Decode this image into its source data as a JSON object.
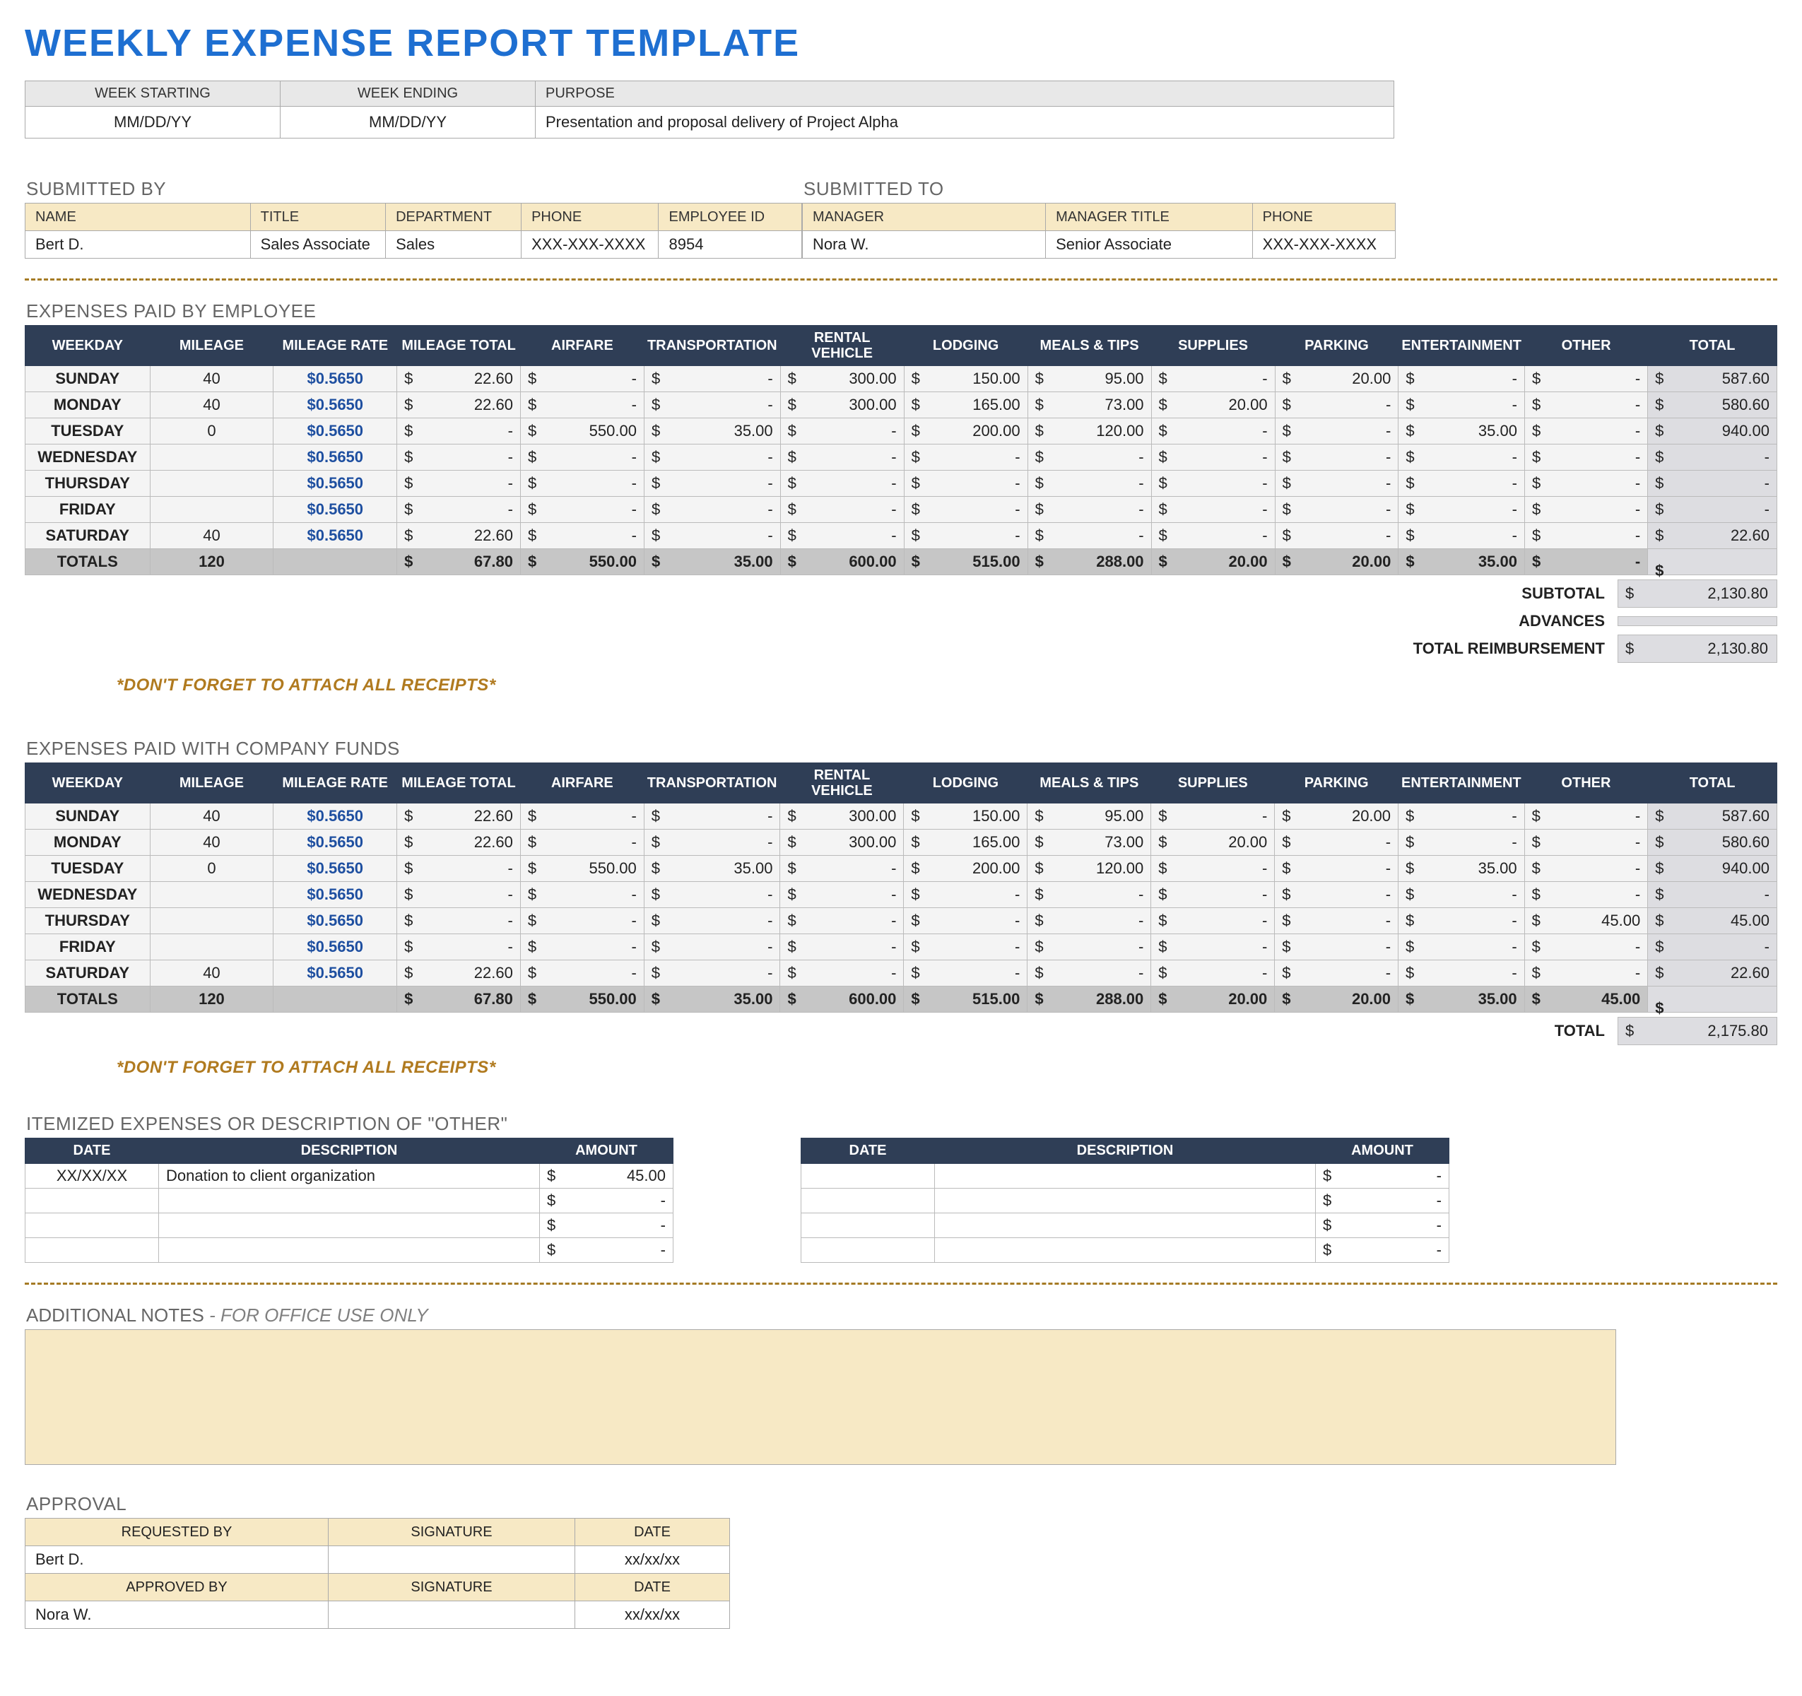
{
  "title": "WEEKLY EXPENSE REPORT TEMPLATE",
  "top": {
    "week_starting_hdr": "WEEK STARTING",
    "week_ending_hdr": "WEEK ENDING",
    "purpose_hdr": "PURPOSE",
    "week_starting": "MM/DD/YY",
    "week_ending": "MM/DD/YY",
    "purpose": "Presentation and proposal delivery of Project Alpha"
  },
  "submitted_by": {
    "section": "SUBMITTED BY",
    "hdr": {
      "name": "NAME",
      "title": "TITLE",
      "dept": "DEPARTMENT",
      "phone": "PHONE",
      "emp": "EMPLOYEE ID"
    },
    "val": {
      "name": "Bert D.",
      "title": "Sales Associate",
      "dept": "Sales",
      "phone": "XXX-XXX-XXXX",
      "emp": "8954"
    }
  },
  "submitted_to": {
    "section": "SUBMITTED TO",
    "hdr": {
      "manager": "MANAGER",
      "title": "MANAGER TITLE",
      "phone": "PHONE"
    },
    "val": {
      "manager": "Nora W.",
      "title": "Senior Associate",
      "phone": "XXX-XXX-XXXX"
    }
  },
  "exp_cols": [
    "WEEKDAY",
    "MILEAGE",
    "MILEAGE RATE",
    "MILEAGE TOTAL",
    "AIRFARE",
    "TRANSPORTATION",
    "RENTAL VEHICLE",
    "LODGING",
    "MEALS & TIPS",
    "SUPPLIES",
    "PARKING",
    "ENTERTAINMENT",
    "OTHER",
    "TOTAL"
  ],
  "exp_colw": [
    168,
    168,
    168,
    168,
    168,
    168,
    168,
    168,
    168,
    168,
    168,
    168,
    168,
    176
  ],
  "emp_section": "EXPENSES PAID BY EMPLOYEE",
  "emp_rows": [
    {
      "day": "SUNDAY",
      "mileage": "40",
      "rate": "$0.5650",
      "mtot": "22.60",
      "air": "-",
      "trans": "-",
      "rent": "300.00",
      "lodg": "150.00",
      "meal": "95.00",
      "sup": "-",
      "park": "20.00",
      "ent": "-",
      "oth": "-",
      "tot": "587.60"
    },
    {
      "day": "MONDAY",
      "mileage": "40",
      "rate": "$0.5650",
      "mtot": "22.60",
      "air": "-",
      "trans": "-",
      "rent": "300.00",
      "lodg": "165.00",
      "meal": "73.00",
      "sup": "20.00",
      "park": "-",
      "ent": "-",
      "oth": "-",
      "tot": "580.60"
    },
    {
      "day": "TUESDAY",
      "mileage": "0",
      "rate": "$0.5650",
      "mtot": "-",
      "air": "550.00",
      "trans": "35.00",
      "rent": "-",
      "lodg": "200.00",
      "meal": "120.00",
      "sup": "-",
      "park": "-",
      "ent": "35.00",
      "oth": "-",
      "tot": "940.00"
    },
    {
      "day": "WEDNESDAY",
      "mileage": "",
      "rate": "$0.5650",
      "mtot": "-",
      "air": "-",
      "trans": "-",
      "rent": "-",
      "lodg": "-",
      "meal": "-",
      "sup": "-",
      "park": "-",
      "ent": "-",
      "oth": "-",
      "tot": "-"
    },
    {
      "day": "THURSDAY",
      "mileage": "",
      "rate": "$0.5650",
      "mtot": "-",
      "air": "-",
      "trans": "-",
      "rent": "-",
      "lodg": "-",
      "meal": "-",
      "sup": "-",
      "park": "-",
      "ent": "-",
      "oth": "-",
      "tot": "-"
    },
    {
      "day": "FRIDAY",
      "mileage": "",
      "rate": "$0.5650",
      "mtot": "-",
      "air": "-",
      "trans": "-",
      "rent": "-",
      "lodg": "-",
      "meal": "-",
      "sup": "-",
      "park": "-",
      "ent": "-",
      "oth": "-",
      "tot": "-"
    },
    {
      "day": "SATURDAY",
      "mileage": "40",
      "rate": "$0.5650",
      "mtot": "22.60",
      "air": "-",
      "trans": "-",
      "rent": "-",
      "lodg": "-",
      "meal": "-",
      "sup": "-",
      "park": "-",
      "ent": "-",
      "oth": "-",
      "tot": "22.60"
    }
  ],
  "emp_totals": {
    "label": "TOTALS",
    "mileage": "120",
    "mtot": "67.80",
    "air": "550.00",
    "trans": "35.00",
    "rent": "600.00",
    "lodg": "515.00",
    "meal": "288.00",
    "sup": "20.00",
    "park": "20.00",
    "ent": "35.00",
    "oth": "-",
    "tot": ""
  },
  "emp_sum": [
    {
      "label": "SUBTOTAL",
      "val": "2,130.80"
    },
    {
      "label": "ADVANCES",
      "val": ""
    },
    {
      "label": "TOTAL REIMBURSEMENT",
      "val": "2,130.80"
    }
  ],
  "reminder": "*DON'T FORGET TO ATTACH ALL RECEIPTS*",
  "co_section": "EXPENSES PAID WITH COMPANY FUNDS",
  "co_rows": [
    {
      "day": "SUNDAY",
      "mileage": "40",
      "rate": "$0.5650",
      "mtot": "22.60",
      "air": "-",
      "trans": "-",
      "rent": "300.00",
      "lodg": "150.00",
      "meal": "95.00",
      "sup": "-",
      "park": "20.00",
      "ent": "-",
      "oth": "-",
      "tot": "587.60"
    },
    {
      "day": "MONDAY",
      "mileage": "40",
      "rate": "$0.5650",
      "mtot": "22.60",
      "air": "-",
      "trans": "-",
      "rent": "300.00",
      "lodg": "165.00",
      "meal": "73.00",
      "sup": "20.00",
      "park": "-",
      "ent": "-",
      "oth": "-",
      "tot": "580.60"
    },
    {
      "day": "TUESDAY",
      "mileage": "0",
      "rate": "$0.5650",
      "mtot": "-",
      "air": "550.00",
      "trans": "35.00",
      "rent": "-",
      "lodg": "200.00",
      "meal": "120.00",
      "sup": "-",
      "park": "-",
      "ent": "35.00",
      "oth": "-",
      "tot": "940.00"
    },
    {
      "day": "WEDNESDAY",
      "mileage": "",
      "rate": "$0.5650",
      "mtot": "-",
      "air": "-",
      "trans": "-",
      "rent": "-",
      "lodg": "-",
      "meal": "-",
      "sup": "-",
      "park": "-",
      "ent": "-",
      "oth": "-",
      "tot": "-"
    },
    {
      "day": "THURSDAY",
      "mileage": "",
      "rate": "$0.5650",
      "mtot": "-",
      "air": "-",
      "trans": "-",
      "rent": "-",
      "lodg": "-",
      "meal": "-",
      "sup": "-",
      "park": "-",
      "ent": "-",
      "oth": "45.00",
      "tot": "45.00"
    },
    {
      "day": "FRIDAY",
      "mileage": "",
      "rate": "$0.5650",
      "mtot": "-",
      "air": "-",
      "trans": "-",
      "rent": "-",
      "lodg": "-",
      "meal": "-",
      "sup": "-",
      "park": "-",
      "ent": "-",
      "oth": "-",
      "tot": "-"
    },
    {
      "day": "SATURDAY",
      "mileage": "40",
      "rate": "$0.5650",
      "mtot": "22.60",
      "air": "-",
      "trans": "-",
      "rent": "-",
      "lodg": "-",
      "meal": "-",
      "sup": "-",
      "park": "-",
      "ent": "-",
      "oth": "-",
      "tot": "22.60"
    }
  ],
  "co_totals": {
    "label": "TOTALS",
    "mileage": "120",
    "mtot": "67.80",
    "air": "550.00",
    "trans": "35.00",
    "rent": "600.00",
    "lodg": "515.00",
    "meal": "288.00",
    "sup": "20.00",
    "park": "20.00",
    "ent": "35.00",
    "oth": "45.00",
    "tot": ""
  },
  "co_sum": [
    {
      "label": "TOTAL",
      "val": "2,175.80"
    }
  ],
  "itemized": {
    "section": "ITEMIZED EXPENSES OR DESCRIPTION OF \"OTHER\"",
    "hdr": {
      "date": "DATE",
      "desc": "DESCRIPTION",
      "amt": "AMOUNT"
    },
    "left": [
      {
        "date": "XX/XX/XX",
        "desc": "Donation to client organization",
        "amt": "45.00"
      },
      {
        "date": "",
        "desc": "",
        "amt": "-"
      },
      {
        "date": "",
        "desc": "",
        "amt": "-"
      },
      {
        "date": "",
        "desc": "",
        "amt": "-"
      }
    ],
    "right": [
      {
        "date": "",
        "desc": "",
        "amt": "-"
      },
      {
        "date": "",
        "desc": "",
        "amt": "-"
      },
      {
        "date": "",
        "desc": "",
        "amt": "-"
      },
      {
        "date": "",
        "desc": "",
        "amt": "-"
      }
    ]
  },
  "notes": {
    "label": "ADDITIONAL NOTES",
    "office": " - FOR OFFICE USE ONLY"
  },
  "approval": {
    "section": "APPROVAL",
    "hdr": {
      "req": "REQUESTED BY",
      "sig": "SIGNATURE",
      "date": "DATE",
      "app": "APPROVED BY"
    },
    "req": {
      "name": "Bert D.",
      "sig": "",
      "date": "xx/xx/xx"
    },
    "app": {
      "name": "Nora W.",
      "sig": "",
      "date": "xx/xx/xx"
    }
  }
}
